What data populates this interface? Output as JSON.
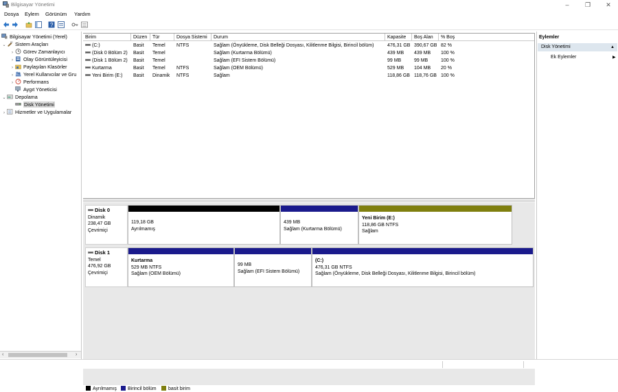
{
  "window": {
    "title": "Bilgisayar Yönetimi",
    "controls": {
      "minimize": "–",
      "restore": "❐",
      "close": "✕"
    }
  },
  "menu": [
    "Dosya",
    "Eylem",
    "Görünüm",
    "Yardım"
  ],
  "toolbar_icons": [
    "back-icon",
    "forward-icon",
    "up-folder-icon",
    "show-hide-tree-icon",
    "help-icon",
    "properties-icon",
    "key-icon",
    "list-view-icon"
  ],
  "tree": {
    "root": "Bilgisayar Yönetimi (Yerel)",
    "system_tools": "Sistem Araçları",
    "task_scheduler": "Görev Zamanlayıcı",
    "event_viewer": "Olay Görüntüleyicisi",
    "shared_folders": "Paylaşılan Klasörler",
    "local_users": "Yerel Kullanıcılar ve Gru",
    "performance": "Performans",
    "device_manager": "Aygıt Yöneticisi",
    "storage": "Depolama",
    "disk_management": "Disk Yönetimi",
    "services": "Hizmetler ve Uygulamalar"
  },
  "volume_table": {
    "columns": [
      "Birim",
      "Düzen",
      "Tür",
      "Dosya Sistemi",
      "Durum",
      "Kapasite",
      "Boş Alan",
      "% Boş"
    ],
    "rows": [
      [
        "(C:)",
        "Basit",
        "Temel",
        "NTFS",
        "Sağlam (Önyükleme, Disk Belleği Dosyası, Kilitlenme Bilgisi, Birincil bölüm)",
        "476,31 GB",
        "390,67 GB",
        "82 %"
      ],
      [
        "(Disk 0 Bölüm 2)",
        "Basit",
        "Temel",
        "",
        "Sağlam (Kurtarma Bölümü)",
        "439 MB",
        "439 MB",
        "100 %"
      ],
      [
        "(Disk 1 Bölüm 2)",
        "Basit",
        "Temel",
        "",
        "Sağlam (EFI Sistem Bölümü)",
        "99 MB",
        "99 MB",
        "100 %"
      ],
      [
        "Kurtarma",
        "Basit",
        "Temel",
        "NTFS",
        "Sağlam (OEM Bölümü)",
        "529 MB",
        "104 MB",
        "20 %"
      ],
      [
        "Yeni Birim (E:)",
        "Basit",
        "Dinamik",
        "NTFS",
        "Sağlam",
        "118,86 GB",
        "118,76 GB",
        "100 %"
      ]
    ]
  },
  "disks": [
    {
      "name": "Disk 0",
      "type": "Dinamik",
      "size": "238,47 GB",
      "status": "Çevrimiçi",
      "partitions": [
        {
          "title": "",
          "line1": "119,18 GB",
          "line2": "Ayrılmamış",
          "bar_color": "#000000"
        },
        {
          "title": "",
          "line1": "439 MB",
          "line2": "Sağlam (Kurtarma Bölümü)",
          "bar_color": "#1a1a8c"
        },
        {
          "title": "Yeni Birim  (E:)",
          "line1": "118,86 GB NTFS",
          "line2": "Sağlam",
          "bar_color": "#7f7f0f"
        }
      ]
    },
    {
      "name": "Disk 1",
      "type": "Temel",
      "size": "476,92 GB",
      "status": "Çevrimiçi",
      "partitions": [
        {
          "title": "Kurtarma",
          "line1": "529 MB NTFS",
          "line2": "Sağlam (OEM Bölümü)",
          "bar_color": "#1a1a8c"
        },
        {
          "title": "",
          "line1": "99 MB",
          "line2": "Sağlam (EFI Sistem Bölümü)",
          "bar_color": "#1a1a8c"
        },
        {
          "title": "(C:)",
          "line1": "476,31 GB NTFS",
          "line2": "Sağlam (Önyükleme, Disk Belleği Dosyası, Kilitlenme Bilgisi, Birincil bölüm)",
          "bar_color": "#1a1a8c"
        }
      ]
    }
  ],
  "legend": [
    {
      "label": "Ayrılmamış",
      "color": "#000000"
    },
    {
      "label": "Birincil bölüm",
      "color": "#1a1a8c"
    },
    {
      "label": "basit birim",
      "color": "#7f7f0f"
    }
  ],
  "actions": {
    "header": "Eylemler",
    "section": "Disk Yönetimi",
    "more": "Ek Eylemler"
  }
}
